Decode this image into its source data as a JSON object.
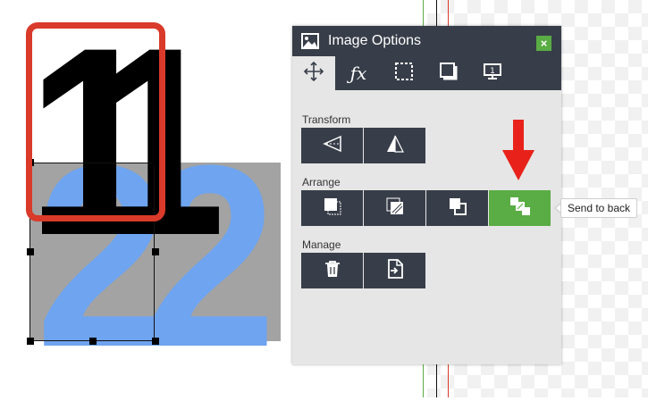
{
  "canvas": {
    "text_top": "11",
    "text_bottom": "22",
    "colors": {
      "top_text": "#000000",
      "bottom_text": "#6ea4f0",
      "box": "#a3a3a3",
      "highlight": "#d93a2a"
    }
  },
  "panel": {
    "title": "Image Options",
    "close_label": "×",
    "tabs": [
      {
        "name": "move-icon"
      },
      {
        "name": "fx-icon"
      },
      {
        "name": "crop-select-icon"
      },
      {
        "name": "shadow-icon"
      },
      {
        "name": "monitor-icon"
      }
    ],
    "sections": {
      "transform": {
        "label": "Transform",
        "buttons": [
          "flip-horizontal-icon",
          "flip-vertical-icon"
        ]
      },
      "arrange": {
        "label": "Arrange",
        "buttons": [
          "bring-to-front-icon",
          "bring-forward-icon",
          "send-backward-icon",
          "send-to-back-icon"
        ]
      },
      "manage": {
        "label": "Manage",
        "buttons": [
          "trash-icon",
          "replace-image-icon"
        ]
      }
    },
    "colors": {
      "header": "#383e49",
      "body": "#e6e6e6",
      "accent": "#5aac44"
    }
  },
  "tooltip": {
    "text": "Send to back"
  },
  "annotation": {
    "arrow_color": "#e8221a"
  }
}
